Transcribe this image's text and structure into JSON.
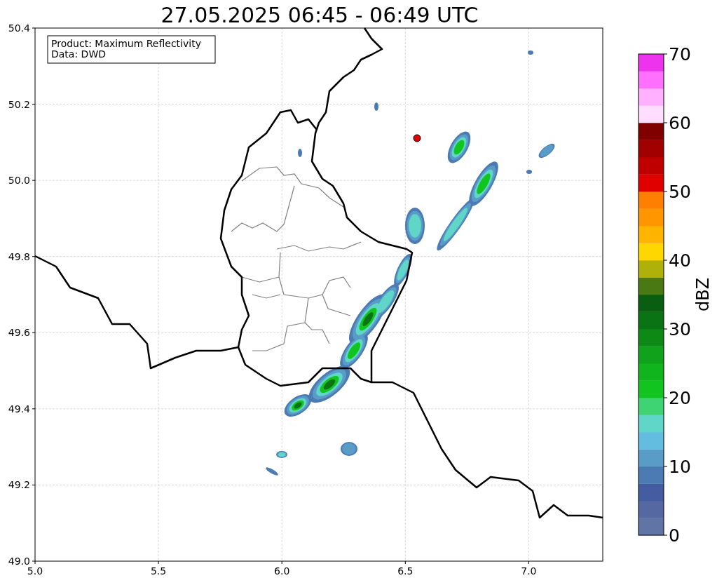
{
  "title": "27.05.2025 06:45 - 06:49 UTC",
  "info_box": [
    "Product: Maximum Reflectivity",
    "Data: DWD"
  ],
  "x_ticks": [
    "5.0",
    "5.5",
    "6.0",
    "6.5",
    "7.0"
  ],
  "y_ticks": [
    "50.4",
    "50.2",
    "50.0",
    "49.8",
    "49.6",
    "49.4",
    "49.2",
    "49.0"
  ],
  "colorbar": {
    "label": "dBZ",
    "ticks": [
      "70",
      "60",
      "50",
      "40",
      "30",
      "20",
      "10",
      "0"
    ],
    "segments": [
      {
        "color": "#6174a6"
      },
      {
        "color": "#5568a2"
      },
      {
        "color": "#435da0"
      },
      {
        "color": "#4b7bb2"
      },
      {
        "color": "#5a9cc8"
      },
      {
        "color": "#62bde0"
      },
      {
        "color": "#5fd6c8"
      },
      {
        "color": "#3ed474"
      },
      {
        "color": "#12c41e"
      },
      {
        "color": "#10b41c"
      },
      {
        "color": "#0fa21a"
      },
      {
        "color": "#0d8a16"
      },
      {
        "color": "#0a7414"
      },
      {
        "color": "#0a5e12"
      },
      {
        "color": "#4a7812"
      },
      {
        "color": "#b0b00a"
      },
      {
        "color": "#ffd700"
      },
      {
        "color": "#ffb400"
      },
      {
        "color": "#ff9600"
      },
      {
        "color": "#ff7f00"
      },
      {
        "color": "#e00000"
      },
      {
        "color": "#c00000"
      },
      {
        "color": "#a00000"
      },
      {
        "color": "#800000"
      },
      {
        "color": "#ffddff"
      },
      {
        "color": "#ffb0ff"
      },
      {
        "color": "#ff70ff"
      },
      {
        "color": "#ee33ee"
      }
    ]
  }
}
